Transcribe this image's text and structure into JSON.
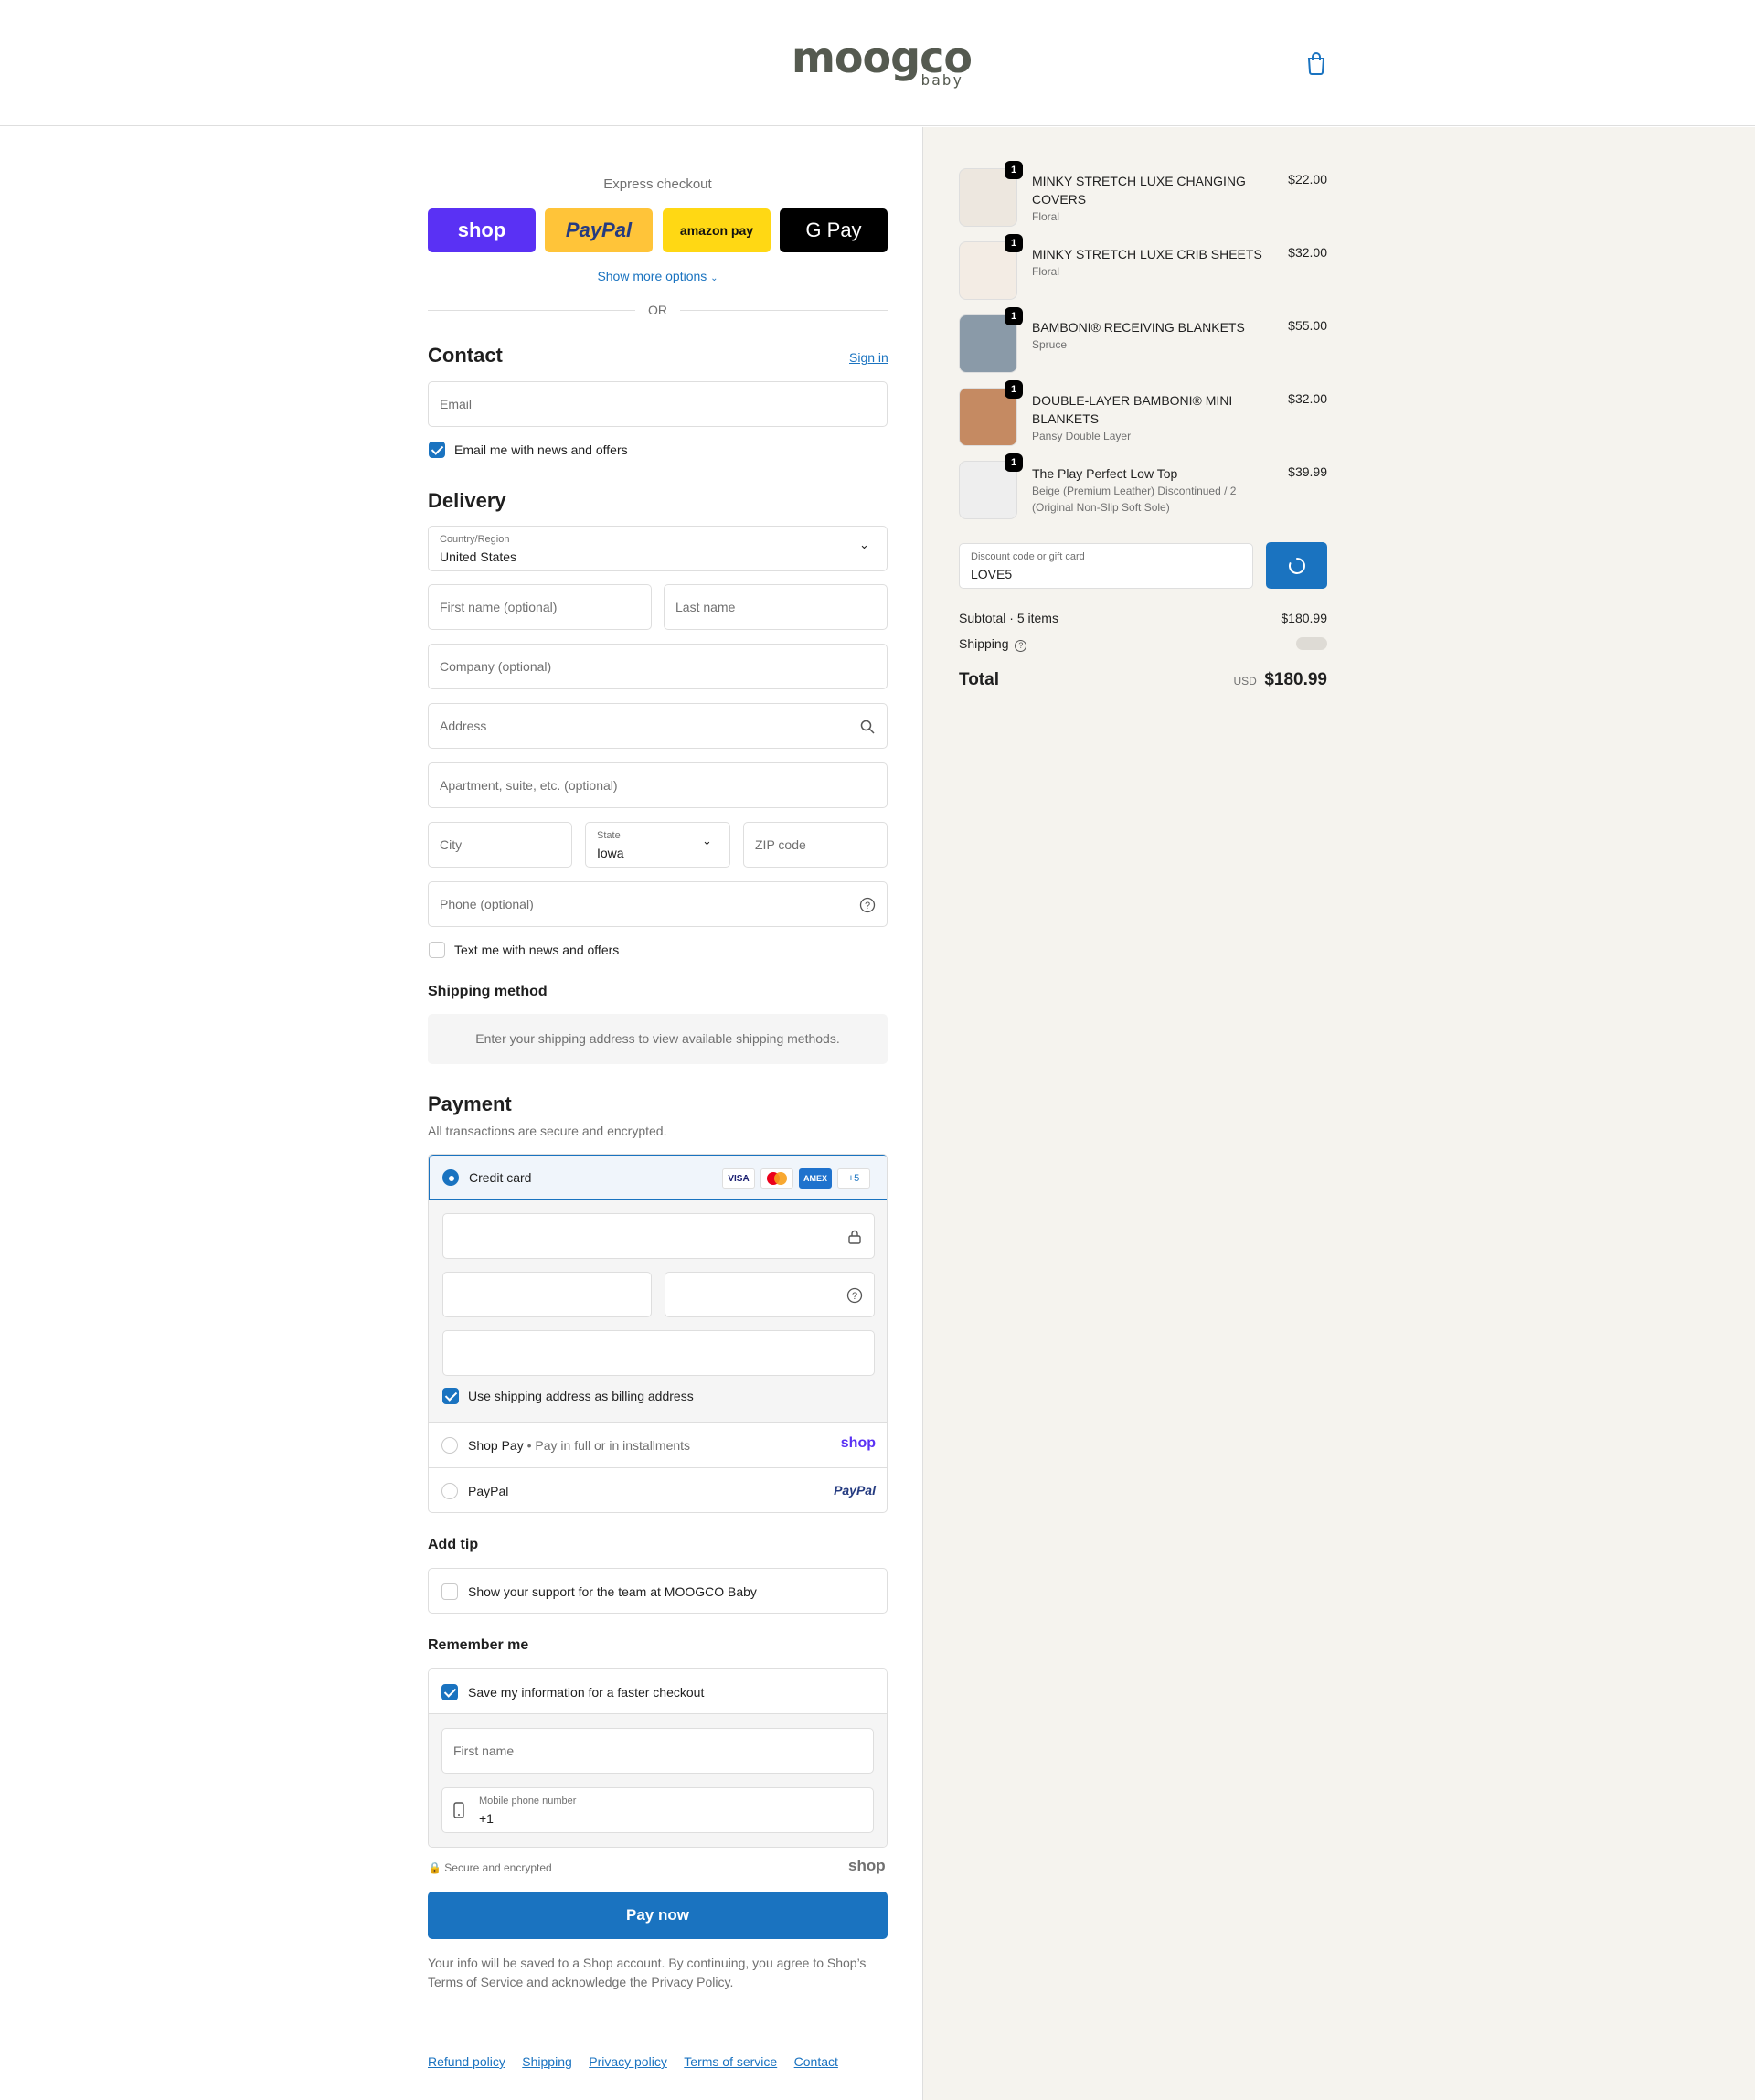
{
  "header": {
    "logo_main": "moogco",
    "logo_sub": "baby",
    "cart_icon": "shopping-bag-icon"
  },
  "express": {
    "title": "Express checkout",
    "buttons": {
      "shop": "shop",
      "paypal": "PayPal",
      "amazon": "amazon pay",
      "gpay": "G Pay"
    },
    "show_more": "Show more options",
    "or": "OR"
  },
  "contact": {
    "heading": "Contact",
    "sign_in": "Sign in",
    "email_placeholder": "Email",
    "email_news_label": "Email me with news and offers",
    "email_news_checked": true
  },
  "delivery": {
    "heading": "Delivery",
    "country_label": "Country/Region",
    "country_value": "United States",
    "first_name_placeholder": "First name (optional)",
    "last_name_placeholder": "Last name",
    "company_placeholder": "Company (optional)",
    "address_placeholder": "Address",
    "apartment_placeholder": "Apartment, suite, etc. (optional)",
    "city_placeholder": "City",
    "state_label": "State",
    "state_value": "Iowa",
    "zip_placeholder": "ZIP code",
    "phone_placeholder": "Phone (optional)",
    "text_news_label": "Text me with news and offers",
    "text_news_checked": false
  },
  "shipping_method": {
    "heading": "Shipping method",
    "message": "Enter your shipping address to view available shipping methods."
  },
  "payment": {
    "heading": "Payment",
    "subtitle": "All transactions are secure and encrypted.",
    "credit_card_label": "Credit card",
    "card_logos": [
      "VISA",
      "MC",
      "AMEX",
      "+5"
    ],
    "billing_same_label": "Use shipping address as billing address",
    "shop_pay_label": "Shop Pay",
    "shop_pay_sub": "Pay in full or in installments",
    "shop_pay_logo": "shop",
    "paypal_label": "PayPal",
    "paypal_logo": "PayPal"
  },
  "tip": {
    "heading": "Add tip",
    "label": "Show your support for the team at MOOGCO Baby"
  },
  "remember": {
    "heading": "Remember me",
    "save_label": "Save my information for a faster checkout",
    "first_name_placeholder": "First name",
    "mobile_label": "Mobile phone number",
    "mobile_value": "+1",
    "secure_label": "Secure and encrypted",
    "shop_logo": "shop"
  },
  "pay_now": "Pay now",
  "legal": {
    "line1": "Your info will be saved to a Shop account. By continuing, you agree to Shop’s",
    "terms": "Terms of Service",
    "mid": "and acknowledge the",
    "privacy": "Privacy Policy",
    "end": "."
  },
  "footer_links": [
    "Refund policy",
    "Shipping",
    "Privacy policy",
    "Terms of service",
    "Contact"
  ],
  "order": {
    "items": [
      {
        "name": "MINKY STRETCH LUXE CHANGING COVERS",
        "variant": "Floral",
        "price": "$22.00",
        "qty": "1"
      },
      {
        "name": "MINKY STRETCH LUXE CRIB SHEETS",
        "variant": "Floral",
        "price": "$32.00",
        "qty": "1"
      },
      {
        "name": "BAMBONI® RECEIVING BLANKETS",
        "variant": "Spruce",
        "price": "$55.00",
        "qty": "1"
      },
      {
        "name": "DOUBLE-LAYER BAMBONI® MINI BLANKETS",
        "variant": "Pansy Double Layer",
        "price": "$32.00",
        "qty": "1"
      },
      {
        "name": "The Play Perfect Low Top",
        "variant": "Beige (Premium Leather) Discontinued / 2 (Original Non-Slip Soft Sole)",
        "price": "$39.99",
        "qty": "1"
      }
    ],
    "discount_label": "Discount code or gift card",
    "discount_value": "LOVE5",
    "subtotal_label": "Subtotal · 5 items",
    "subtotal_value": "$180.99",
    "shipping_label": "Shipping",
    "total_label": "Total",
    "currency": "USD",
    "total_value": "$180.99"
  },
  "colors": {
    "accent": "#1a73c0",
    "shop_purple": "#5a31f4",
    "paypal_yellow": "#ffc439",
    "summary_bg": "#f5f3ee"
  }
}
